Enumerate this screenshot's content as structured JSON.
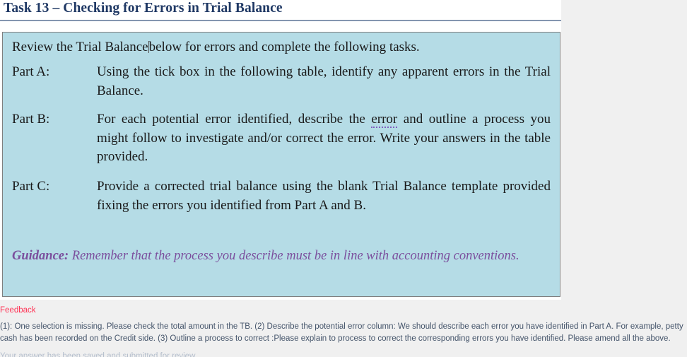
{
  "document": {
    "heading": "Task 13 – Checking for Errors in Trial Balance",
    "intro_before_caret": "Review the Trial Balance",
    "intro_after_caret": "below for errors and complete the following tasks.",
    "parts": [
      {
        "label": "Part A:",
        "text": "Using the tick box in the following table, identify any apparent errors in the Trial Balance."
      },
      {
        "label": "Part B:",
        "text_1": "For each potential error identified, describe the ",
        "spellchecked_word": "error",
        "text_2": " and outline a process you might follow to investigate and/or correct the error. Write your answers in the table provided."
      },
      {
        "label": "Part C:",
        "text": "Provide a corrected trial balance using the blank Trial Balance template provided fixing the errors you identified from Part A and B."
      }
    ],
    "guidance": {
      "label": "Guidance:",
      "text": " Remember that the process you describe must be in line with accounting conventions."
    }
  },
  "feedback": {
    "title": "Feedback",
    "body": "(1): One selection is missing. Please check the total amount in the TB. (2) Describe the potential error column: We should describe each error you have identified in Part A. For example, petty cash has been recorded on the Credit side. (3) Outline a process to correct :Please explain to process to correct the corresponding errors you have identified. Please amend all the above.",
    "tail": "Your answer has been saved and submitted for review."
  },
  "colors": {
    "heading": "#1f3864",
    "rule": "#8496b0",
    "task_box_fill": "#b5dce6",
    "task_box_border": "#7f7f7f",
    "guidance_text": "#7b4f9d",
    "feedback_title": "#ff3355",
    "feedback_body": "#44546a",
    "page_background": "#f0f0f0",
    "sheet": "#ffffff"
  }
}
